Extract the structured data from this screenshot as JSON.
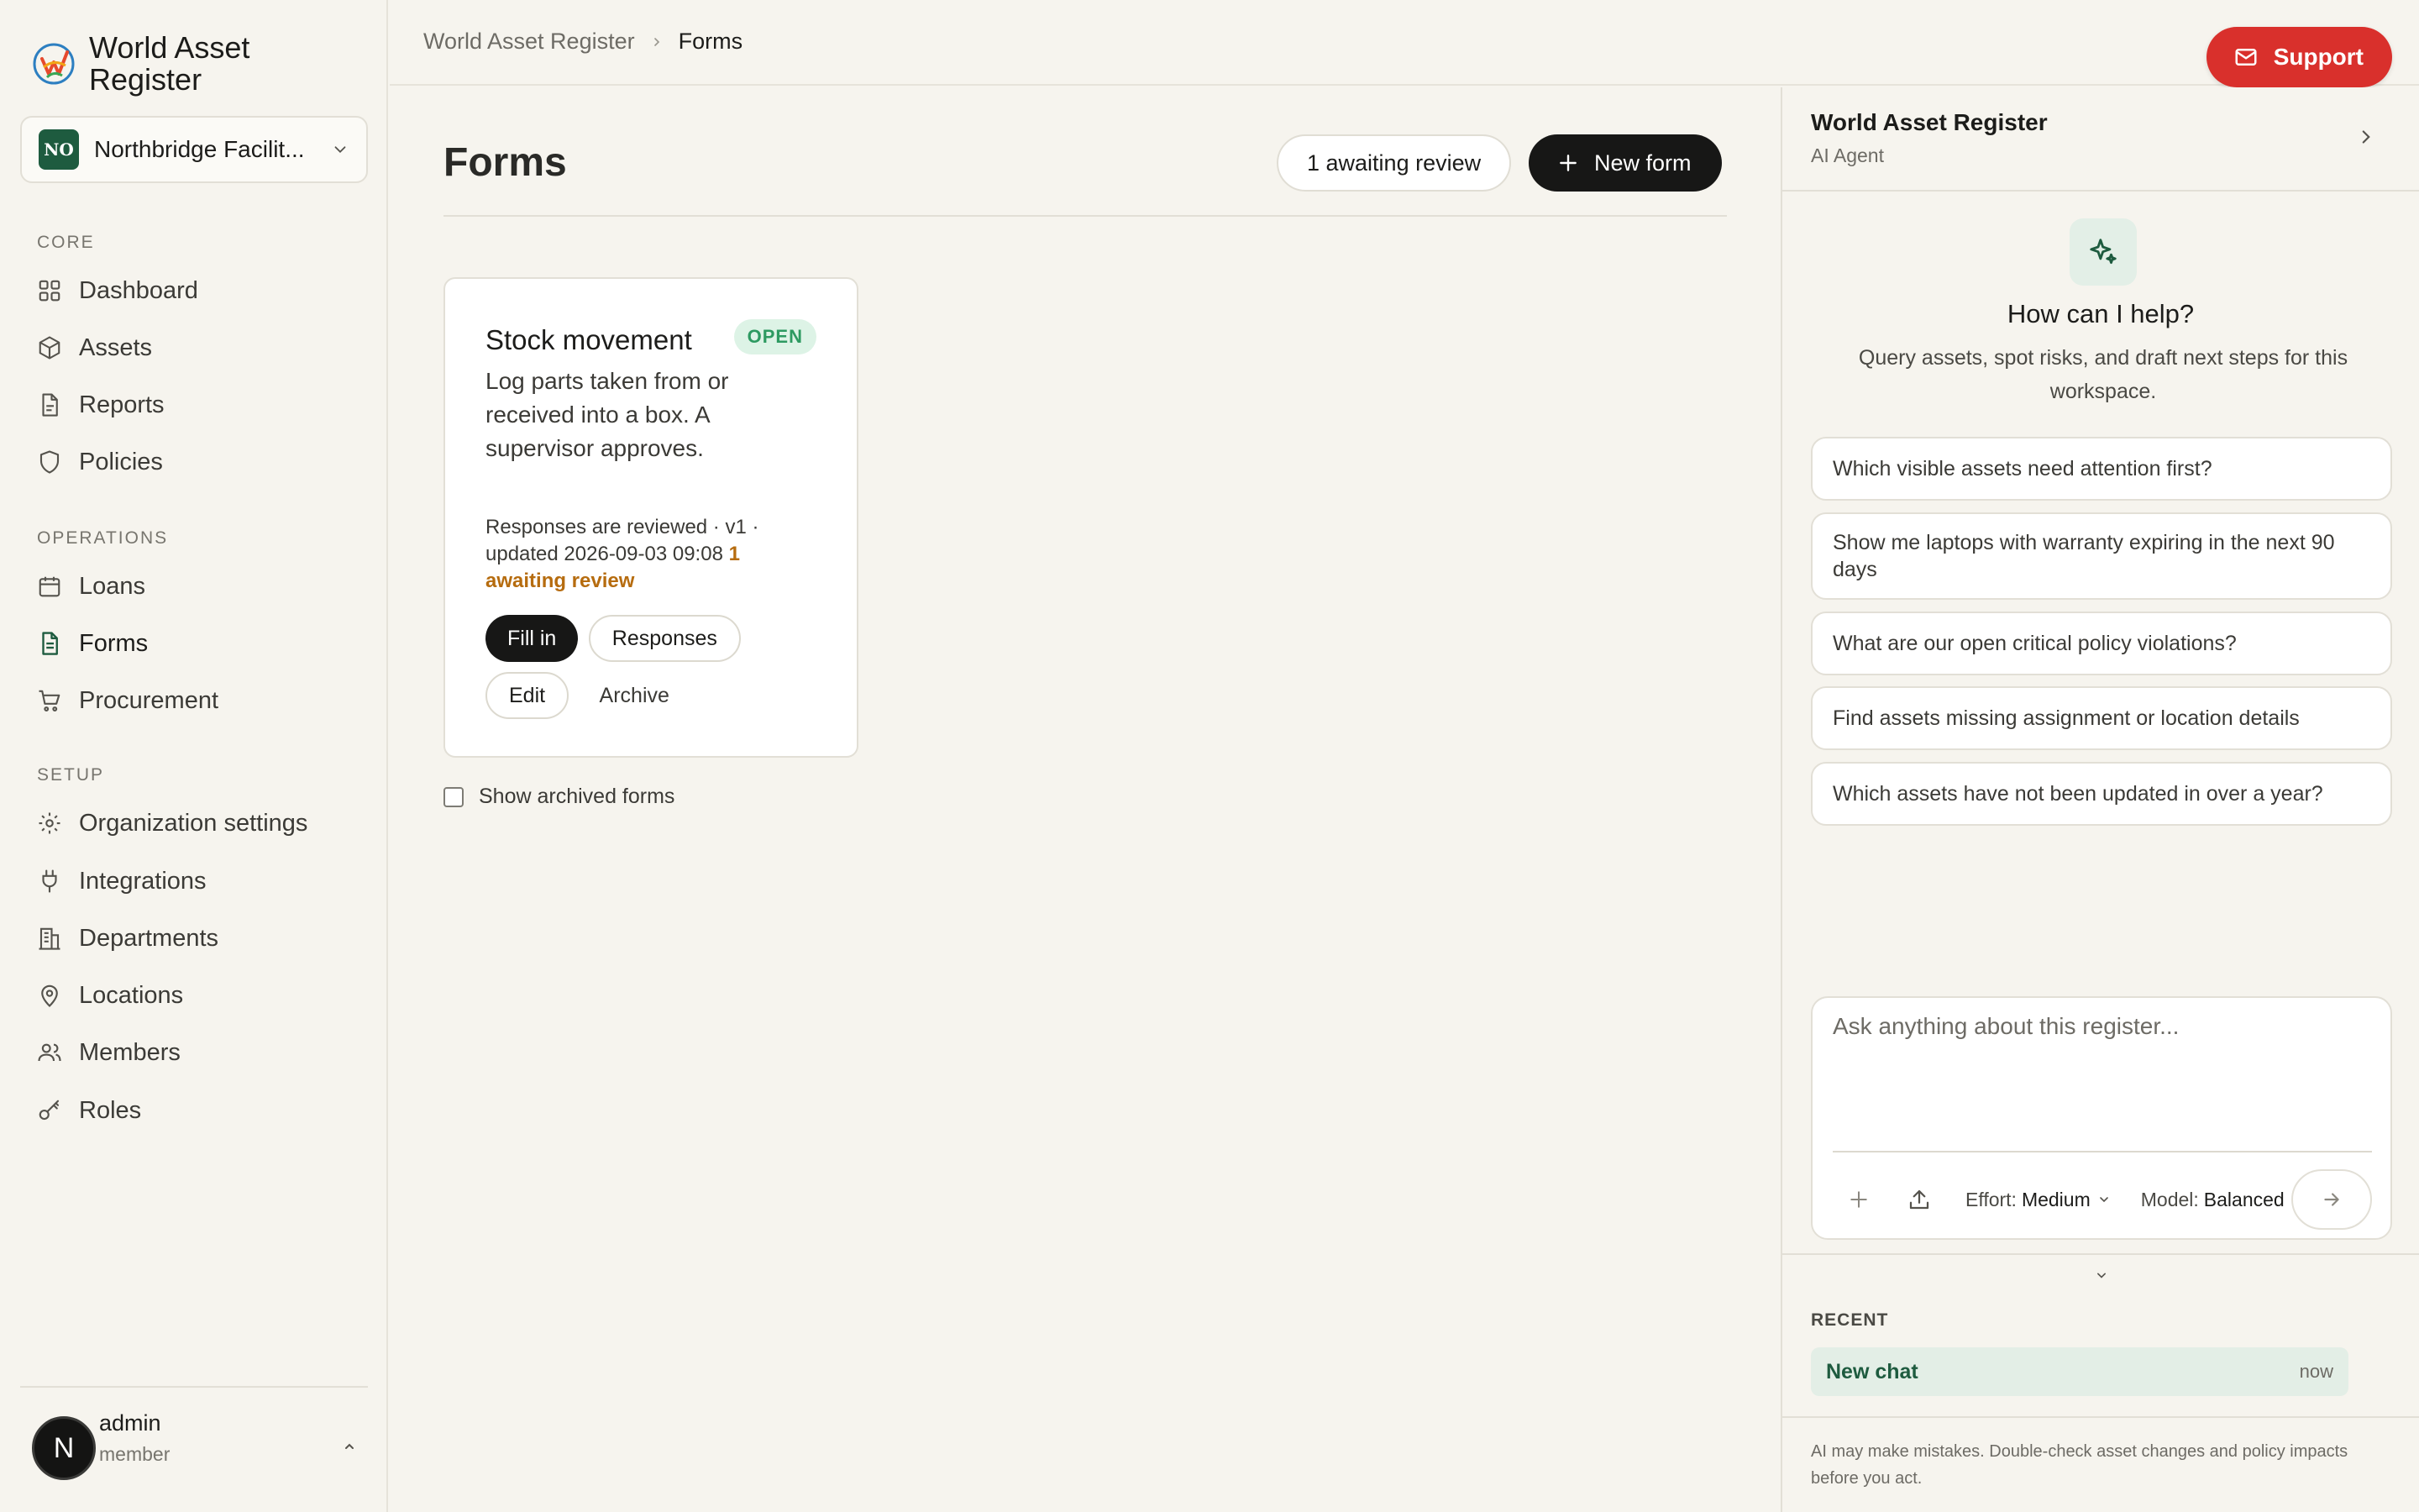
{
  "brand": {
    "name": "World Asset Register"
  },
  "org": {
    "initials": "NO",
    "name": "Northbridge Facilit..."
  },
  "nav": {
    "core_label": "CORE",
    "core": [
      {
        "label": "Dashboard",
        "icon": "dashboard-icon"
      },
      {
        "label": "Assets",
        "icon": "box-icon"
      },
      {
        "label": "Reports",
        "icon": "document-icon"
      },
      {
        "label": "Policies",
        "icon": "shield-icon"
      }
    ],
    "operations_label": "OPERATIONS",
    "operations": [
      {
        "label": "Loans",
        "icon": "calendar-icon"
      },
      {
        "label": "Forms",
        "icon": "form-icon",
        "active": true
      },
      {
        "label": "Procurement",
        "icon": "cart-icon"
      }
    ],
    "setup_label": "SETUP",
    "setup": [
      {
        "label": "Organization settings",
        "icon": "gear-icon"
      },
      {
        "label": "Integrations",
        "icon": "plug-icon"
      },
      {
        "label": "Departments",
        "icon": "building-icon"
      },
      {
        "label": "Locations",
        "icon": "map-pin-icon"
      },
      {
        "label": "Members",
        "icon": "users-icon"
      },
      {
        "label": "Roles",
        "icon": "key-icon"
      }
    ]
  },
  "user": {
    "avatar_letter": "N",
    "name": "admin",
    "role": "member"
  },
  "breadcrumb": {
    "root": "World Asset Register",
    "current": "Forms"
  },
  "support": {
    "label": "Support"
  },
  "page": {
    "title": "Forms",
    "awaiting_label": "1 awaiting review",
    "new_form_label": "New form",
    "show_archived_label": "Show archived forms"
  },
  "form_card": {
    "title": "Stock movement",
    "status": "OPEN",
    "description": "Log parts taken from or received into a box. A supervisor approves.",
    "meta": "Responses are reviewed · v1 · updated 2026-09-03 09:08",
    "awaiting": "1 awaiting review",
    "actions": {
      "fill_in": "Fill in",
      "responses": "Responses",
      "edit": "Edit",
      "archive": "Archive"
    }
  },
  "ai": {
    "title": "World Asset Register",
    "subtitle": "AI Agent",
    "help_title": "How can I help?",
    "help_sub": "Query assets, spot risks, and draft next steps for this workspace.",
    "suggestions": [
      "Which visible assets need attention first?",
      "Show me laptops with warranty expiring in the next 90 days",
      "What are our open critical policy violations?",
      "Find assets missing assignment or location details",
      "Which assets have not been updated in over a year?"
    ],
    "input_placeholder": "Ask anything about this register...",
    "effort_label": "Effort:",
    "effort_value": "Medium",
    "model_label": "Model:",
    "model_value": "Balanced",
    "recent_label": "RECENT",
    "recent_items": [
      {
        "title": "New chat",
        "time": "now"
      }
    ],
    "disclaimer": "AI may make mistakes. Double-check asset changes and policy impacts before you act."
  },
  "colors": {
    "accent_green": "#1e5b3f",
    "support_red": "#d9302c",
    "open_green": "#2d9a61",
    "warning": "#b66c0f"
  }
}
